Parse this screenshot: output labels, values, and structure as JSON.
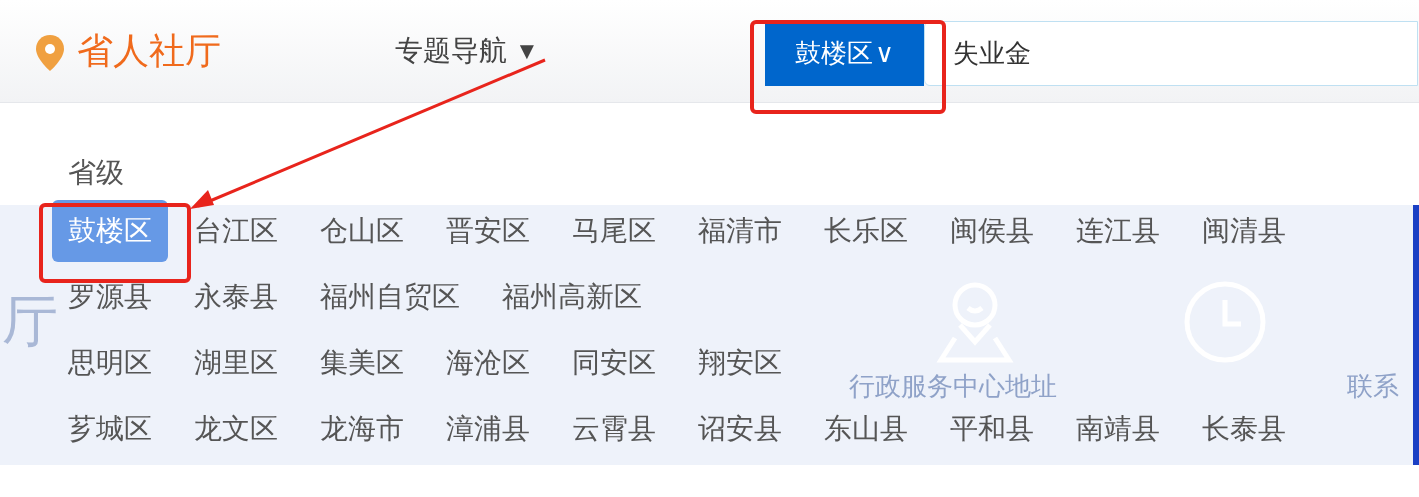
{
  "header": {
    "logo": "省人社厅",
    "nav_menu": {
      "label": "专题导航",
      "caret": "▼"
    },
    "region_button": {
      "label": "鼓楼区",
      "caret": "∨"
    },
    "search": {
      "value": "失业金"
    }
  },
  "dropdown": {
    "level_label": "省级",
    "groups": [
      {
        "items": [
          {
            "label": "鼓楼区",
            "selected": true
          },
          {
            "label": "台江区",
            "selected": false
          },
          {
            "label": "仓山区",
            "selected": false
          },
          {
            "label": "晋安区",
            "selected": false
          },
          {
            "label": "马尾区",
            "selected": false
          },
          {
            "label": "福清市",
            "selected": false
          },
          {
            "label": "长乐区",
            "selected": false
          },
          {
            "label": "闽侯县",
            "selected": false
          },
          {
            "label": "连江县",
            "selected": false
          },
          {
            "label": "闽清县",
            "selected": false
          },
          {
            "label": "罗源县",
            "selected": false
          },
          {
            "label": "永泰县",
            "selected": false
          },
          {
            "label": "福州自贸区",
            "selected": false
          },
          {
            "label": "福州高新区",
            "selected": false
          }
        ]
      },
      {
        "items": [
          {
            "label": "思明区",
            "selected": false
          },
          {
            "label": "湖里区",
            "selected": false
          },
          {
            "label": "集美区",
            "selected": false
          },
          {
            "label": "海沧区",
            "selected": false
          },
          {
            "label": "同安区",
            "selected": false
          },
          {
            "label": "翔安区",
            "selected": false
          }
        ]
      },
      {
        "items": [
          {
            "label": "芗城区",
            "selected": false
          },
          {
            "label": "龙文区",
            "selected": false
          },
          {
            "label": "龙海市",
            "selected": false
          },
          {
            "label": "漳浦县",
            "selected": false
          },
          {
            "label": "云霄县",
            "selected": false
          },
          {
            "label": "诏安县",
            "selected": false
          },
          {
            "label": "东山县",
            "selected": false
          },
          {
            "label": "平和县",
            "selected": false
          },
          {
            "label": "南靖县",
            "selected": false
          },
          {
            "label": "长泰县",
            "selected": false
          }
        ]
      }
    ]
  },
  "banner": {
    "title": "厅",
    "links": [
      "行政服务中心地址",
      "联系"
    ]
  }
}
